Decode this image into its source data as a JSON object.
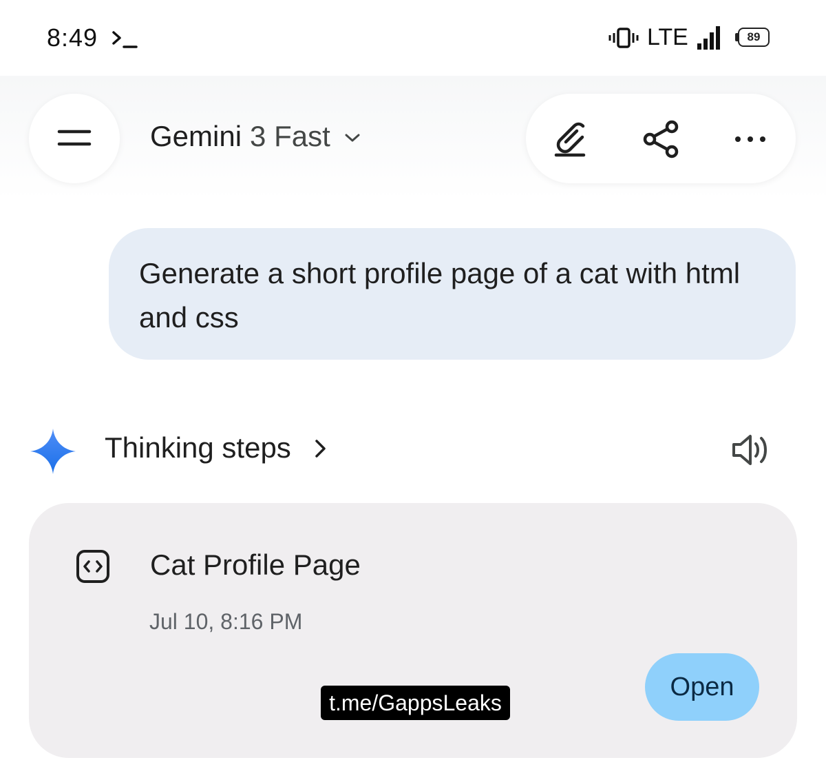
{
  "status_bar": {
    "time": "8:49",
    "network": "LTE",
    "battery": "89",
    "icons": [
      "terminal-icon",
      "vibrate-icon",
      "signal-icon",
      "battery-icon"
    ]
  },
  "header": {
    "menu_icon": "menu-icon",
    "app_name": "Gemini",
    "model": "3 Fast",
    "model_dropdown_icon": "chevron-down-icon",
    "actions": [
      "edit-icon",
      "share-icon",
      "more-icon"
    ]
  },
  "user_message": {
    "text": "Generate a short profile page of a cat with html and css"
  },
  "response": {
    "logo_icon": "gemini-sparkle-icon",
    "thinking_label": "Thinking steps",
    "speaker_icon": "speaker-icon",
    "colors": {
      "sparkle_top": "#4285f4",
      "sparkle_bottom": "#1a73e8"
    }
  },
  "artifact_card": {
    "icon": "code-icon",
    "title": "Cat Profile Page",
    "date": "Jul 10, 8:16 PM",
    "open_label": "Open",
    "colors": {
      "card_bg": "#f0eef0",
      "open_bg": "#8fd0fb"
    }
  },
  "watermark": {
    "text": "t.me/GappsLeaks"
  },
  "colors": {
    "user_bubble": "#e6edf6",
    "text": "#1f1f1f",
    "secondary_text": "#5f6368"
  }
}
